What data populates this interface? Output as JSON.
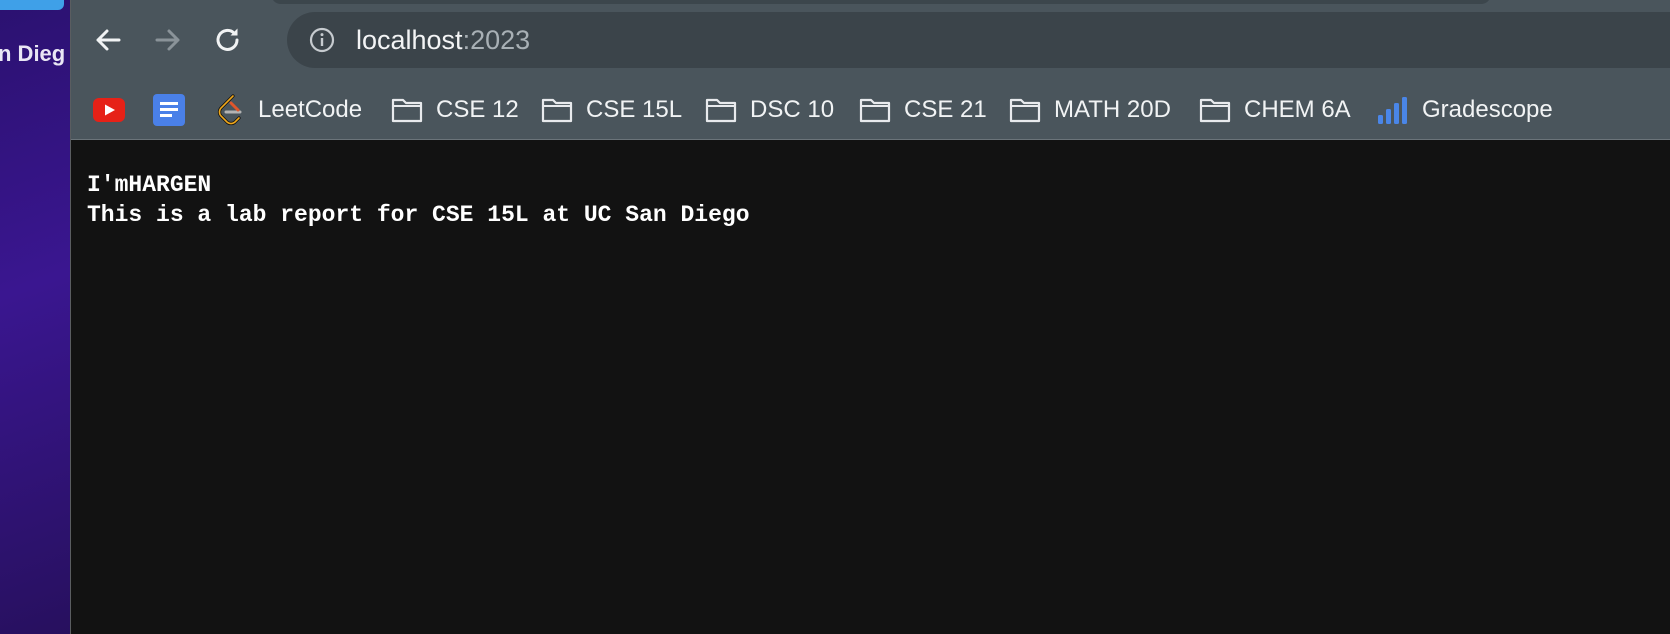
{
  "desktop": {
    "sidebar_text": "n Dieg"
  },
  "browser": {
    "address_bar": {
      "host": "localhost",
      "port": ":2023"
    },
    "bookmarks": [
      {
        "label": "",
        "icon": "youtube-icon"
      },
      {
        "label": "",
        "icon": "google-docs-icon"
      },
      {
        "label": "LeetCode",
        "icon": "leetcode-icon"
      },
      {
        "label": "CSE 12",
        "icon": "folder-icon"
      },
      {
        "label": "CSE 15L",
        "icon": "folder-icon"
      },
      {
        "label": "DSC 10",
        "icon": "folder-icon"
      },
      {
        "label": "CSE 21",
        "icon": "folder-icon"
      },
      {
        "label": "MATH 20D",
        "icon": "folder-icon"
      },
      {
        "label": "CHEM 6A",
        "icon": "folder-icon"
      },
      {
        "label": "Gradescope",
        "icon": "gradescope-icon"
      }
    ]
  },
  "page": {
    "lines": [
      "I'mHARGEN",
      "This is a lab report for CSE 15L at UC San Diego"
    ]
  },
  "colors": {
    "toolbar": "#4a555c",
    "omnibox": "#3b444a",
    "page_background": "#121212",
    "page_text": "#ffffff",
    "youtube_red": "#e62117",
    "docs_blue": "#4a80e8",
    "gradescope_blue": "#4a86e8"
  }
}
